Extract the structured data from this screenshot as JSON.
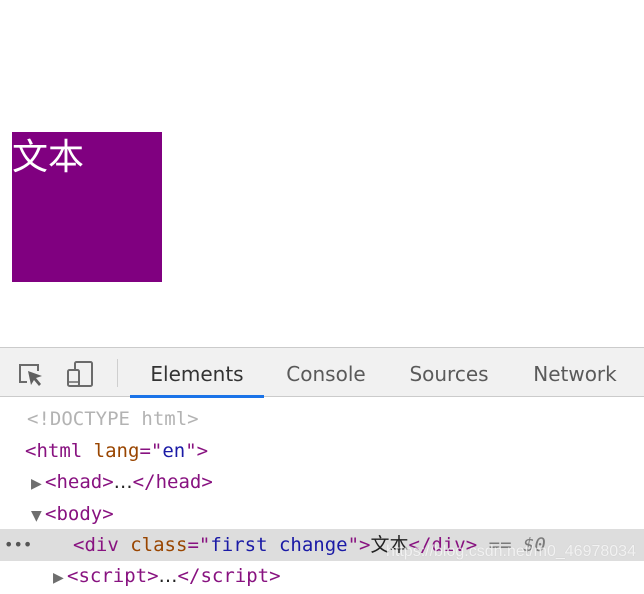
{
  "page": {
    "box_text": "文本",
    "box_color": "#800080"
  },
  "devtools": {
    "toolbar": {
      "inspect_icon": "inspect-element-icon",
      "device_icon": "device-toolbar-icon",
      "tabs": [
        {
          "label": "Elements",
          "active": true
        },
        {
          "label": "Console",
          "active": false
        },
        {
          "label": "Sources",
          "active": false
        },
        {
          "label": "Network",
          "active": false
        }
      ],
      "accent": "#1a73e8"
    },
    "dom": {
      "doctype": "<!DOCTYPE html>",
      "html_open": {
        "tag": "html",
        "attr": "lang",
        "value": "en"
      },
      "head": {
        "tag": "head",
        "collapsed_text": "…"
      },
      "body": {
        "tag": "body"
      },
      "selected_div": {
        "tag": "div",
        "attr": "class",
        "value": "first change",
        "text": "文本",
        "console_ref": "== $0",
        "dots": "•••"
      },
      "next_line": {
        "tag": "script",
        "collapsed_text": "…"
      }
    }
  },
  "watermark": "https://blog.csdn.net/m0_46978034"
}
